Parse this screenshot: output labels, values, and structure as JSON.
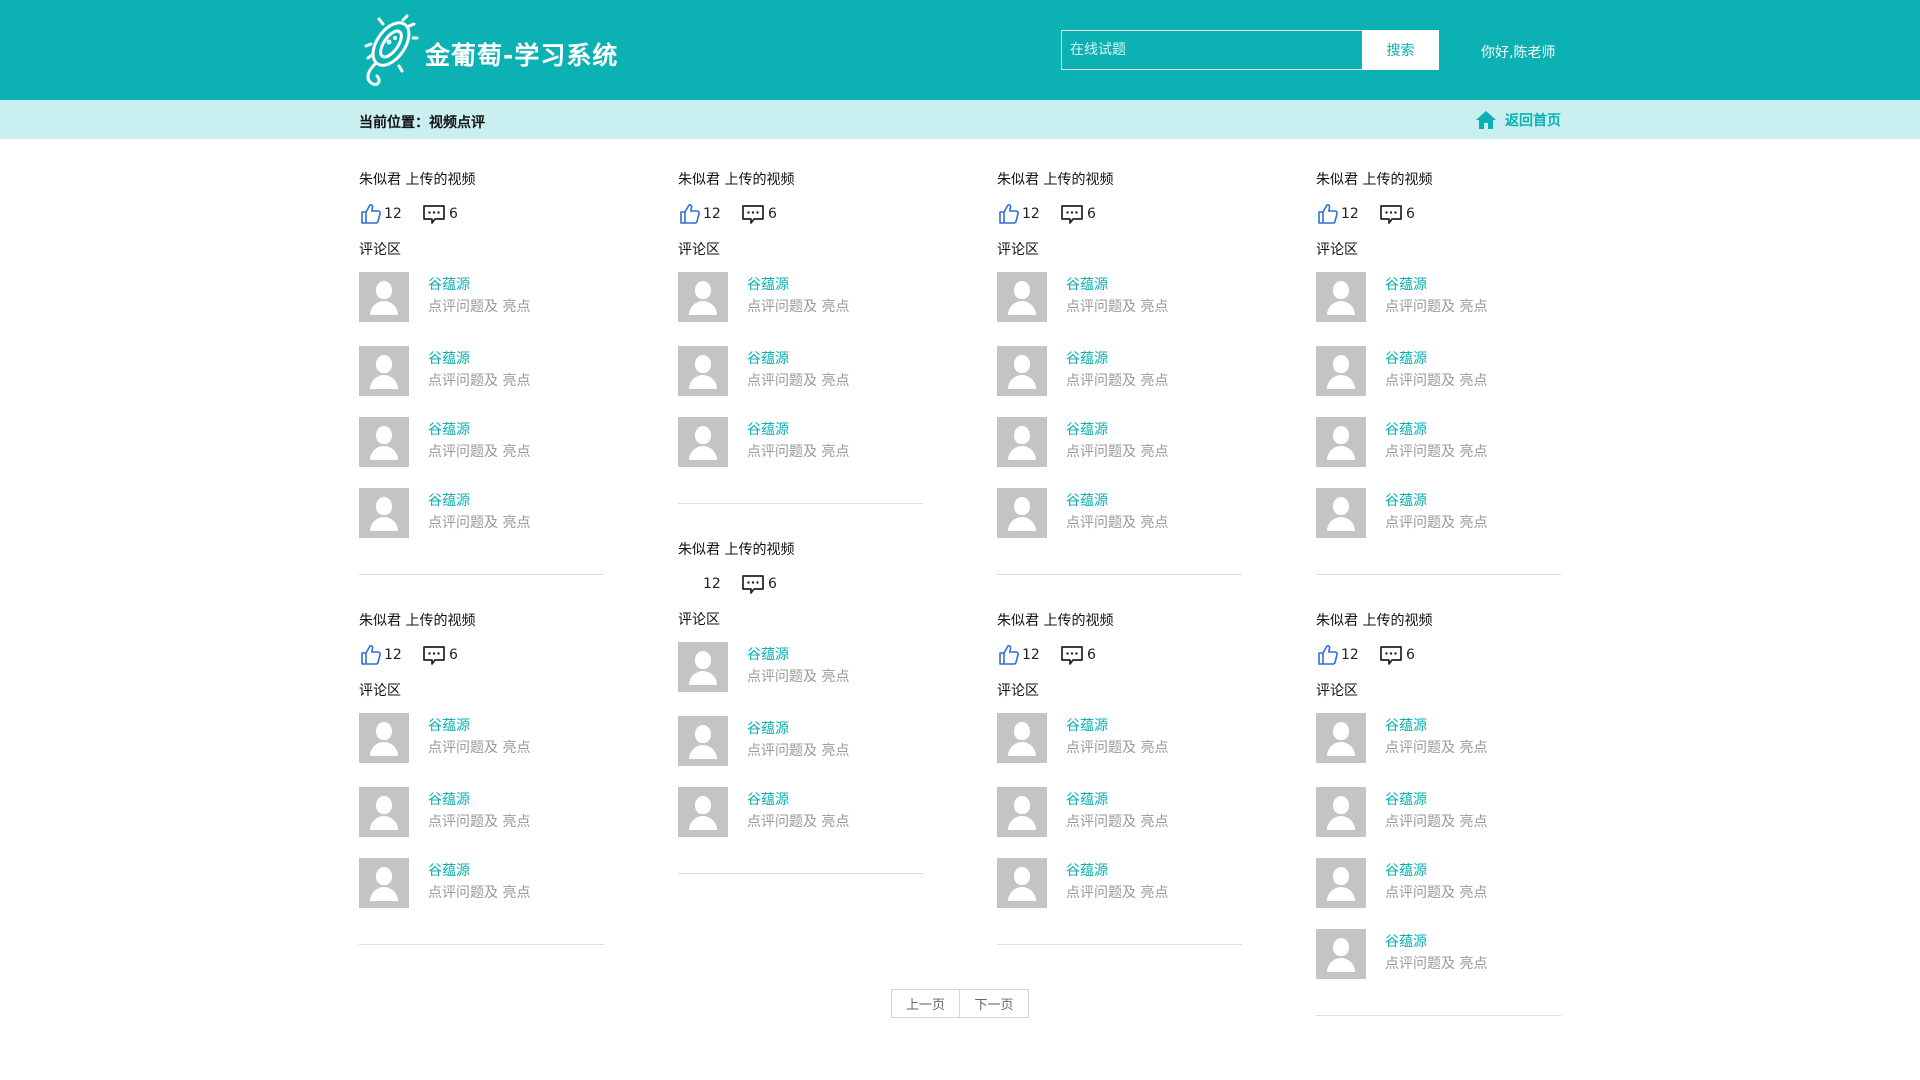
{
  "header": {
    "brand": "金葡萄-学习系统",
    "search_placeholder": "在线试题",
    "search_button": "搜索",
    "greeting": "你好,陈老师"
  },
  "breadcrumb": {
    "text": "当前位置：视频点评",
    "home_link": "返回首页"
  },
  "labels": {
    "comment_zone": "评论区"
  },
  "columns": [
    [
      {
        "title": "朱似君 上传的视频",
        "likes": "12",
        "comments": "6",
        "reviews": [
          {
            "name": "谷蕴源",
            "text": "点评问题及 亮点"
          },
          {
            "name": "谷蕴源",
            "text": "点评问题及 亮点"
          },
          {
            "name": "谷蕴源",
            "text": "点评问题及 亮点"
          },
          {
            "name": "谷蕴源",
            "text": "点评问题及 亮点"
          }
        ]
      },
      {
        "title": "朱似君 上传的视频",
        "likes": "12",
        "comments": "6",
        "reviews": [
          {
            "name": "谷蕴源",
            "text": "点评问题及 亮点"
          },
          {
            "name": "谷蕴源",
            "text": "点评问题及 亮点"
          },
          {
            "name": "谷蕴源",
            "text": "点评问题及 亮点"
          }
        ]
      }
    ],
    [
      {
        "title": "朱似君 上传的视频",
        "likes": "12",
        "comments": "6",
        "reviews": [
          {
            "name": "谷蕴源",
            "text": "点评问题及 亮点"
          },
          {
            "name": "谷蕴源",
            "text": "点评问题及 亮点"
          },
          {
            "name": "谷蕴源",
            "text": "点评问题及 亮点"
          }
        ]
      },
      {
        "title": "朱似君 上传的视频",
        "likes": "12",
        "comments": "6",
        "hide_like_icon": true,
        "reviews": [
          {
            "name": "谷蕴源",
            "text": "点评问题及 亮点"
          },
          {
            "name": "谷蕴源",
            "text": "点评问题及 亮点"
          },
          {
            "name": "谷蕴源",
            "text": "点评问题及 亮点"
          }
        ]
      }
    ],
    [
      {
        "title": "朱似君 上传的视频",
        "likes": "12",
        "comments": "6",
        "reviews": [
          {
            "name": "谷蕴源",
            "text": "点评问题及 亮点"
          },
          {
            "name": "谷蕴源",
            "text": "点评问题及 亮点"
          },
          {
            "name": "谷蕴源",
            "text": "点评问题及 亮点"
          },
          {
            "name": "谷蕴源",
            "text": "点评问题及 亮点"
          }
        ]
      },
      {
        "title": "朱似君 上传的视频",
        "likes": "12",
        "comments": "6",
        "reviews": [
          {
            "name": "谷蕴源",
            "text": "点评问题及 亮点"
          },
          {
            "name": "谷蕴源",
            "text": "点评问题及 亮点"
          },
          {
            "name": "谷蕴源",
            "text": "点评问题及 亮点"
          }
        ]
      }
    ],
    [
      {
        "title": "朱似君 上传的视频",
        "likes": "12",
        "comments": "6",
        "reviews": [
          {
            "name": "谷蕴源",
            "text": "点评问题及 亮点"
          },
          {
            "name": "谷蕴源",
            "text": "点评问题及 亮点"
          },
          {
            "name": "谷蕴源",
            "text": "点评问题及 亮点"
          },
          {
            "name": "谷蕴源",
            "text": "点评问题及 亮点"
          }
        ]
      },
      {
        "title": "朱似君 上传的视频",
        "likes": "12",
        "comments": "6",
        "reviews": [
          {
            "name": "谷蕴源",
            "text": "点评问题及 亮点"
          },
          {
            "name": "谷蕴源",
            "text": "点评问题及 亮点"
          },
          {
            "name": "谷蕴源",
            "text": "点评问题及 亮点"
          },
          {
            "name": "谷蕴源",
            "text": "点评问题及 亮点"
          }
        ]
      }
    ]
  ],
  "pagination": {
    "prev": "上一页",
    "next": "下一页"
  },
  "colors": {
    "brand": "#0cb1b4",
    "crumb_bg": "#c9eff0",
    "like_icon": "#2f6fd6"
  }
}
